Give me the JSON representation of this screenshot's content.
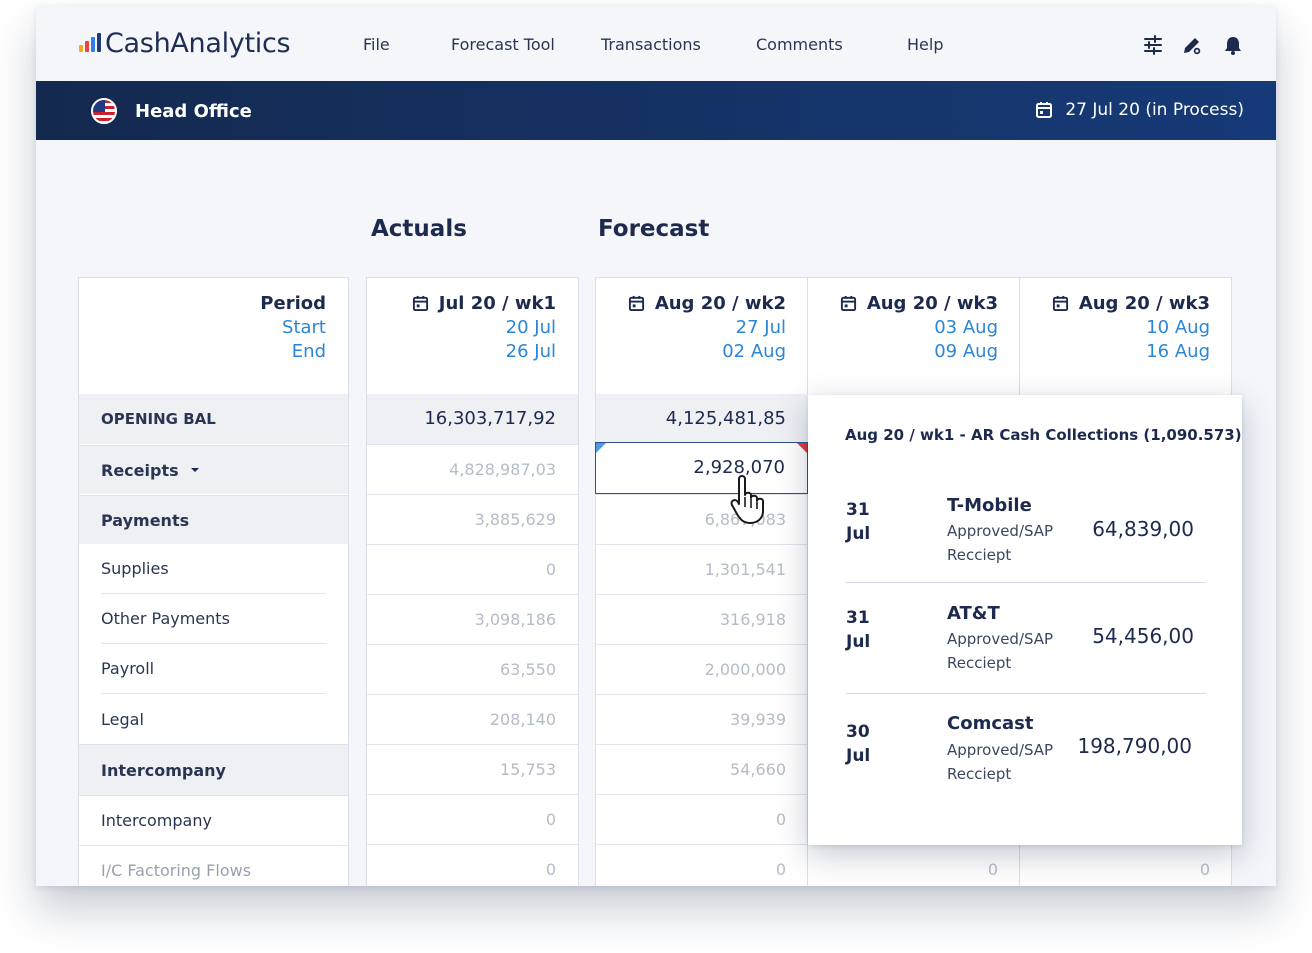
{
  "app": {
    "logo_text": "CashAnalytics",
    "logo_colors": [
      "#f5a623",
      "#e8453c",
      "#2f80ed",
      "#1f3b82"
    ]
  },
  "menu": {
    "file": "File",
    "forecast_tool": "Forecast Tool",
    "transactions": "Transactions",
    "comments": "Comments",
    "help": "Help"
  },
  "top_icons": [
    "sliders-icon",
    "pen-gear-icon",
    "bell-icon"
  ],
  "banner": {
    "entity": "Head Office",
    "date_status": "27 Jul 20 (in Process)"
  },
  "sections": {
    "actuals": "Actuals",
    "forecast": "Forecast"
  },
  "period_header": {
    "title": "Period",
    "start": "Start",
    "end": "End"
  },
  "row_labels": {
    "opening_bal": "OPENING BAL",
    "receipts": "Receipts",
    "payments": "Payments",
    "supplies": "Supplies",
    "other_payments": "Other Payments",
    "payroll": "Payroll",
    "legal": "Legal",
    "intercompany_group": "Intercompany",
    "intercompany": "Intercompany",
    "ic_factoring": "I/C Factoring Flows"
  },
  "columns": [
    {
      "title": "Jul 20 / wk1",
      "start": "20 Jul",
      "end": "26 Jul",
      "opening_bal": "16,303,717,92",
      "receipts": "4,828,987,03",
      "payments": "3,885,629",
      "supplies": "0",
      "other_payments": "3,098,186",
      "payroll": "63,550",
      "legal": "208,140",
      "intercompany_group": "15,753",
      "intercompany": "0",
      "ic_factoring": "0"
    },
    {
      "title": "Aug 20 / wk2",
      "start": "27 Jul",
      "end": "02 Aug",
      "opening_bal": "4,125,481,85",
      "receipts": "2,928,070",
      "payments": "6,867,083",
      "supplies": "1,301,541",
      "other_payments": "316,918",
      "payroll": "2,000,000",
      "legal": "39,939",
      "intercompany_group": "54,660",
      "intercompany": "0",
      "ic_factoring": "0"
    },
    {
      "title": "Aug 20 / wk3",
      "start": "03 Aug",
      "end": "09 Aug",
      "ic_factoring": "0"
    },
    {
      "title": "Aug 20 / wk3",
      "start": "10 Aug",
      "end": "16 Aug",
      "ic_factoring": "0"
    }
  ],
  "popup": {
    "title": "Aug 20 / wk1 - AR Cash Collections (1,090.573)",
    "entries": [
      {
        "day": "31",
        "month": "Jul",
        "name": "T-Mobile",
        "status_1": "Approved/SAP",
        "status_2": "Recciept",
        "amount": "64,839,00"
      },
      {
        "day": "31",
        "month": "Jul",
        "name": "AT&T",
        "status_1": "Approved/SAP",
        "status_2": "Recciept",
        "amount": "54,456,00"
      },
      {
        "day": "30",
        "month": "Jul",
        "name": "Comcast",
        "status_1": "Approved/SAP",
        "status_2": "Recciept",
        "amount": "198,790,00"
      }
    ]
  },
  "colors": {
    "navy": "#1d2a4d",
    "banner_start": "#14294f",
    "banner_end": "#163a78",
    "link_blue": "#2a86d6",
    "muted": "#b6bcc7",
    "marker_blue": "#4d9be6",
    "marker_red": "#e0393b"
  }
}
